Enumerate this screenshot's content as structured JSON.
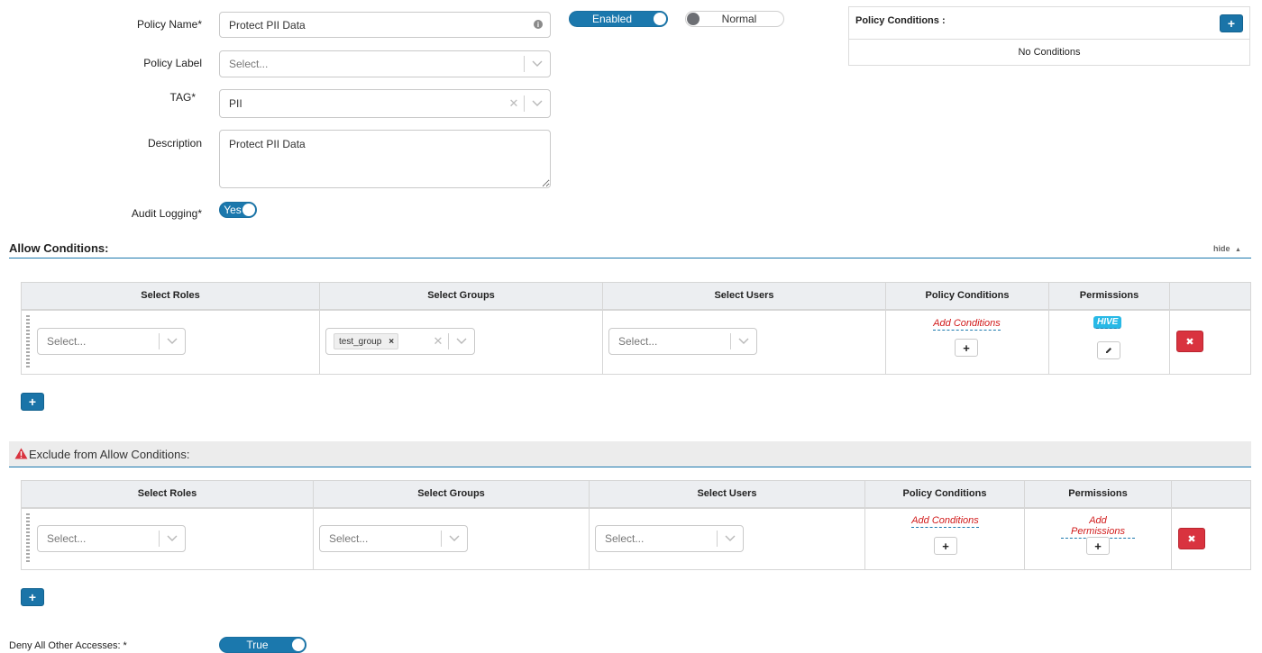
{
  "policy": {
    "name_label": "Policy Name*",
    "name_value": "Protect PII Data",
    "label_label": "Policy Label",
    "label_placeholder": "Select...",
    "tag_label": "TAG*",
    "tag_value": "PII",
    "description_label": "Description",
    "description_value": "Protect PII Data",
    "audit_label": "Audit Logging*",
    "audit_toggle": "Yes",
    "enabled_toggle": "Enabled",
    "priority_toggle": "Normal"
  },
  "policy_conditions_panel": {
    "title": "Policy Conditions :",
    "add_glyph": "+",
    "empty_text": "No Conditions"
  },
  "allow": {
    "title": "Allow Conditions:",
    "hide_label": "hide",
    "headers": [
      "Select Roles",
      "Select Groups",
      "Select Users",
      "Policy Conditions",
      "Permissions"
    ],
    "row": {
      "roles_placeholder": "Select...",
      "group_chip": "test_group",
      "chip_remove": "×",
      "users_placeholder": "Select...",
      "add_conditions_link": "Add Conditions",
      "permission_badge": "HIVE"
    },
    "add_row_glyph": "+"
  },
  "exclude": {
    "title": "Exclude from Allow Conditions:",
    "headers": [
      "Select Roles",
      "Select Groups",
      "Select Users",
      "Policy Conditions",
      "Permissions"
    ],
    "row": {
      "roles_placeholder": "Select...",
      "groups_placeholder": "Select...",
      "users_placeholder": "Select...",
      "add_conditions_link": "Add Conditions",
      "add_permissions_link": "Add Permissions"
    },
    "add_row_glyph": "+"
  },
  "deny": {
    "label": "Deny All Other Accesses: *",
    "toggle": "True"
  },
  "icons": {
    "info": "info-icon",
    "chevron": "chevron-down-icon",
    "clear": "clear-icon",
    "warning": "warning-icon",
    "pencil": "pencil-icon",
    "delete": "delete-icon"
  },
  "colors": {
    "primary": "#1b78ad",
    "danger": "#d9333f",
    "link": "#d11a1a",
    "badge": "#28b9e6"
  }
}
